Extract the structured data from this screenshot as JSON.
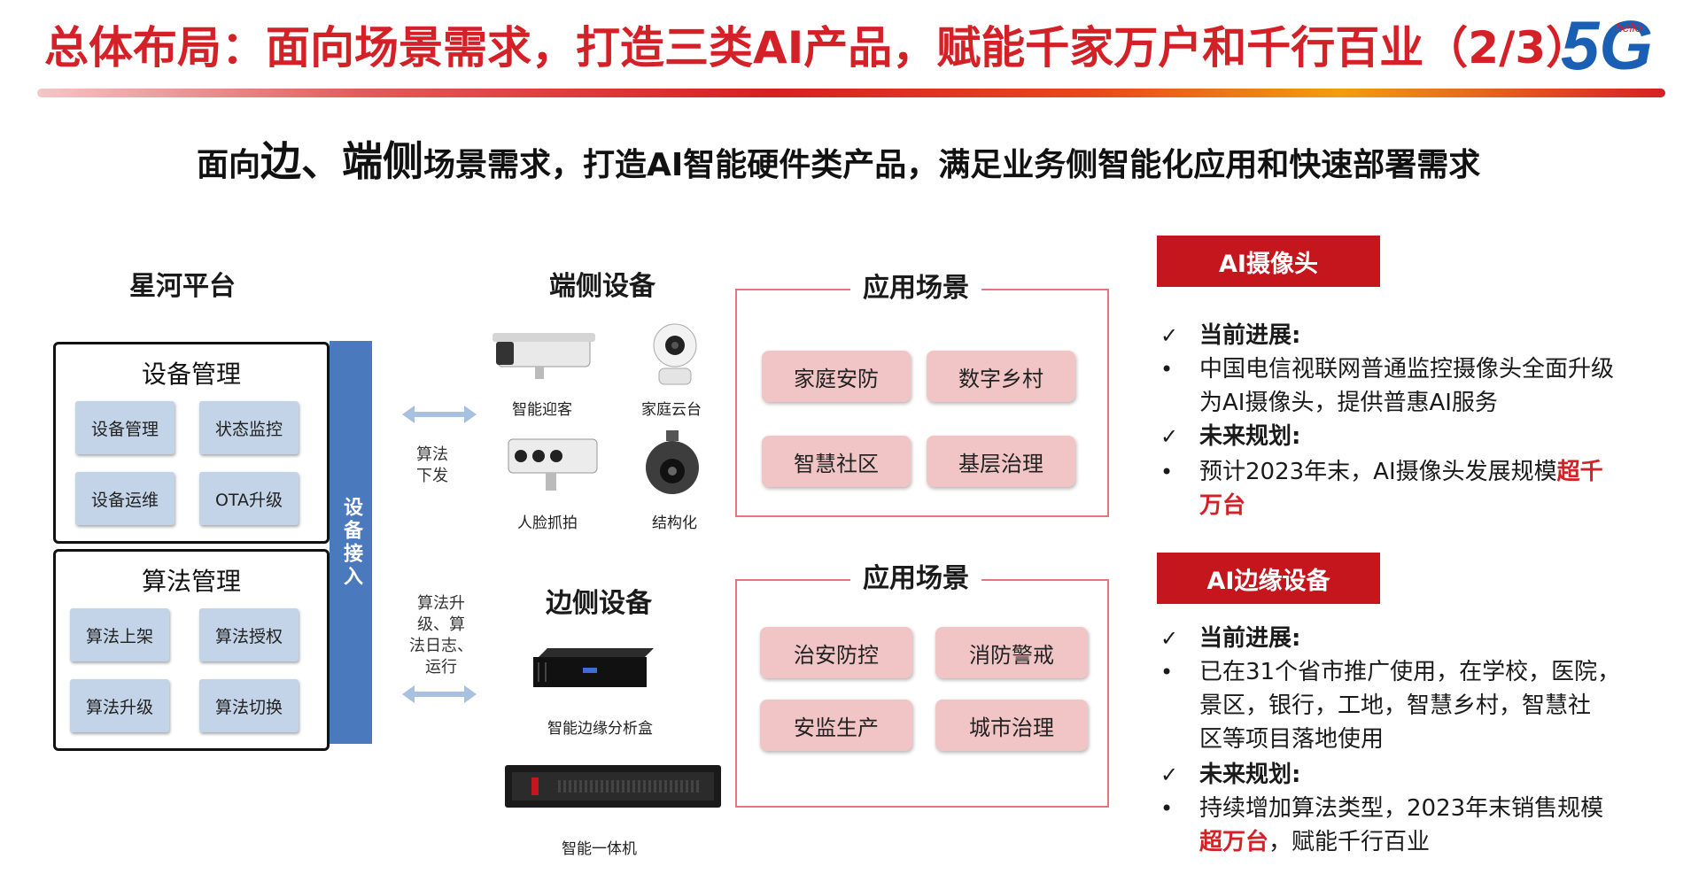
{
  "header": {
    "title": "总体布局：面向场景需求，打造三类AI产品，赋能千家万户和千行百业（2/3）",
    "logo_text": "5G",
    "logo_small": "hello",
    "subtitle_1": "面向",
    "subtitle_big": "边、端侧",
    "subtitle_2": "场景需求，打造AI智能硬件类产品，满足业务侧智能化应用和快速部署需求"
  },
  "platform": {
    "title": "星河平台",
    "device_mgmt": {
      "title": "设备管理",
      "items": [
        "设备管理",
        "状态监控",
        "设备运维",
        "OTA升级"
      ]
    },
    "algo_mgmt": {
      "title": "算法管理",
      "items": [
        "算法上架",
        "算法授权",
        "算法升级",
        "算法切换"
      ]
    },
    "access_bar": "设备接入"
  },
  "arrows": {
    "top_label": "算法\n下发",
    "bottom_label": "算法升\n级、算\n法日志、\n运行"
  },
  "end_devices": {
    "title": "端侧设备",
    "items": [
      "智能迎客",
      "家庭云台",
      "人脸抓拍",
      "结构化"
    ]
  },
  "edge_devices": {
    "title": "边侧设备",
    "items": [
      "智能边缘分析盒",
      "智能一体机"
    ]
  },
  "scenes_top": {
    "title": "应用场景",
    "items": [
      "家庭安防",
      "数字乡村",
      "智慧社区",
      "基层治理"
    ]
  },
  "scenes_bottom": {
    "title": "应用场景",
    "items": [
      "治安防控",
      "消防警戒",
      "安监生产",
      "城市治理"
    ]
  },
  "camera": {
    "tag": "AI摄像头",
    "progress_head": "当前进展:",
    "progress_lines": [
      "中国电信视联网普通监控摄像头全面升级",
      "为AI摄像头，提供普惠AI服务"
    ],
    "plan_head": "未来规划:",
    "plan_line1_pre": "预计2023年末，AI摄像头发展规模",
    "plan_line1_hl": "超千",
    "plan_line2_hl": "万台"
  },
  "edge": {
    "tag": "AI边缘设备",
    "progress_head": "当前进展:",
    "progress_lines": [
      "已在31个省市推广使用，在学校，医院，",
      "景区，银行，工地，智慧乡村，智慧社",
      "区等项目落地使用"
    ],
    "plan_head": "未来规划:",
    "plan_line1": "持续增加算法类型，2023年末销售规模",
    "plan_line2_hl": "超万台",
    "plan_line2_post": "，赋能千行百业"
  },
  "colors": {
    "brand_red": "#d42027",
    "bar_blue": "#4a79be",
    "chip_blue": "#c3d3e8",
    "scene_pink": "#f1c5c6",
    "tag_red": "#c5161d"
  },
  "icons": {
    "check": "✓",
    "bullet": "•"
  }
}
